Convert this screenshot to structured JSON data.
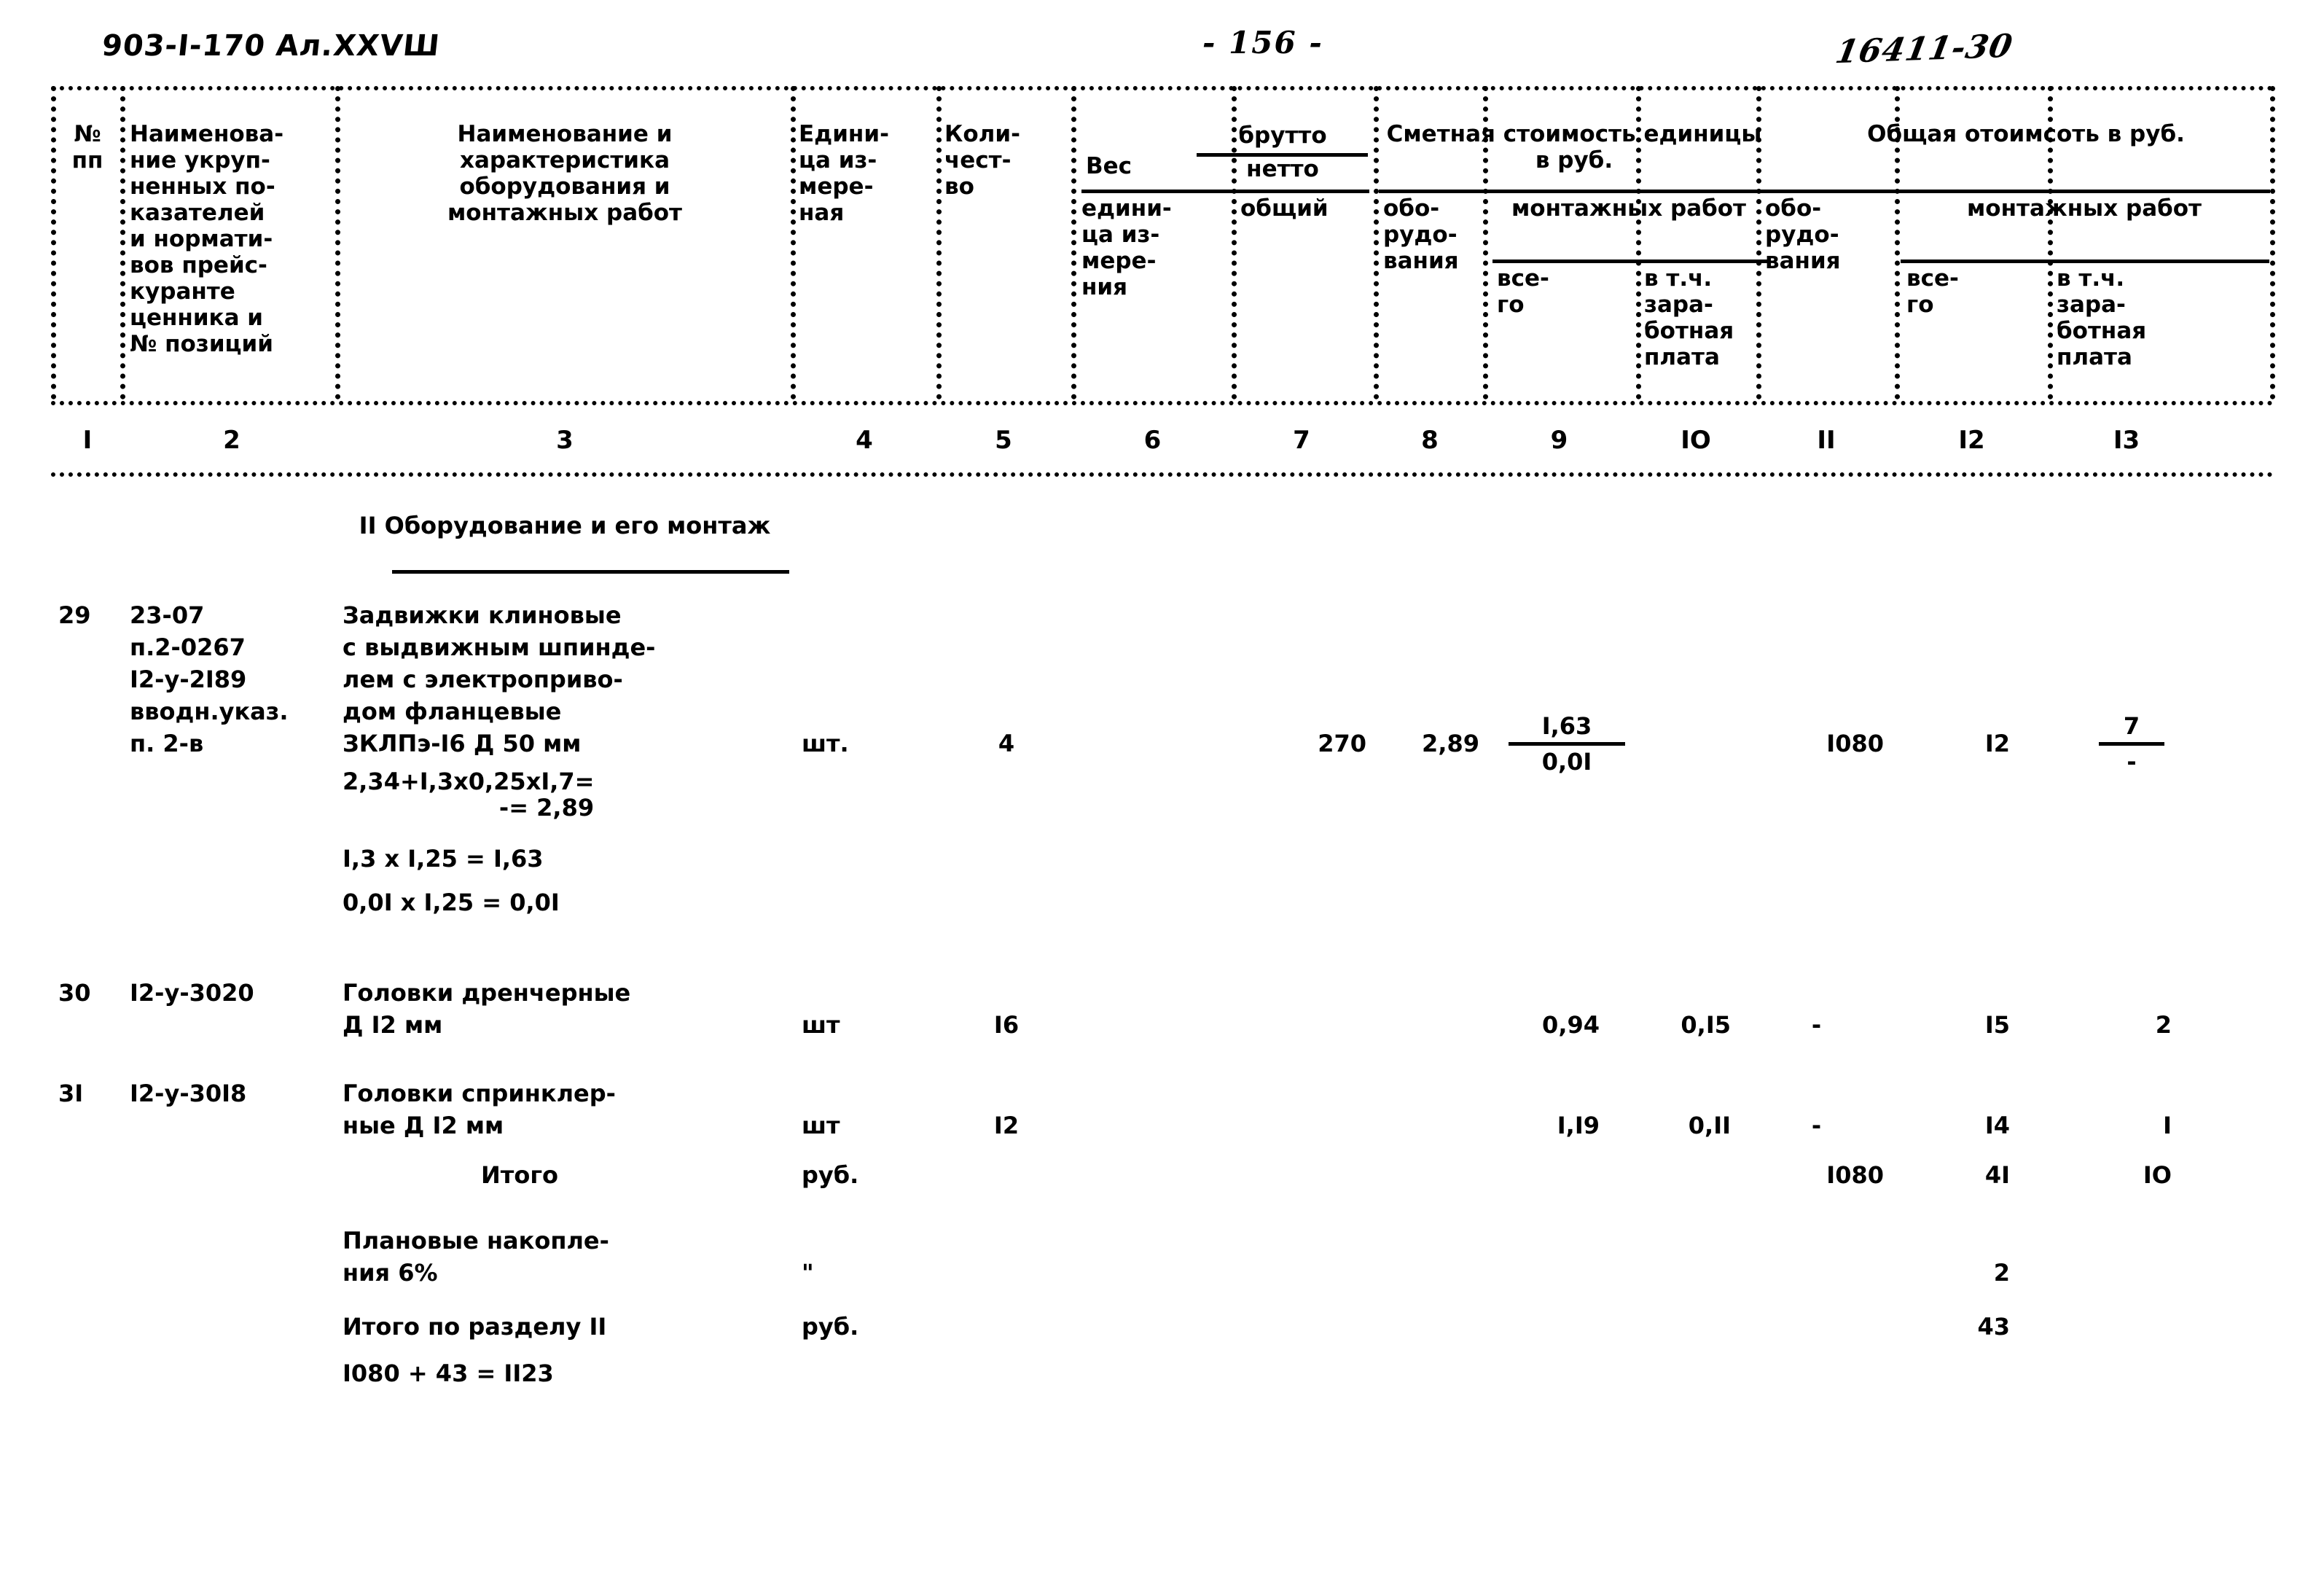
{
  "header": {
    "doc_code": "903-I-170 Ал.XXVШ",
    "page_number": "- 156 -",
    "stamp_number": "16411-30"
  },
  "table": {
    "columns": [
      {
        "num": "I",
        "title": "№\nпп"
      },
      {
        "num": "2",
        "title": "Наименова-\nние укруп-\nненных по-\nказателей\nи нормати-\nвов прейс-\nкуранте\nценника и\n№ позиций"
      },
      {
        "num": "3",
        "title": "Наименование и\nхарактеристика\nоборудования и\nмонтажных работ"
      },
      {
        "num": "4",
        "title": "Едини-\nца из-\nмере-\nная"
      },
      {
        "num": "5",
        "title": "Коли-\nчест-\nво"
      },
      {
        "num": "6",
        "title": "едини-\nца из-\nмере-\nния"
      },
      {
        "num": "7",
        "title": "общий"
      },
      {
        "num": "8",
        "title": "обо-\nрудо-\nвания"
      },
      {
        "num": "9",
        "title": "все-\nго"
      },
      {
        "num": "IO",
        "title": "в т.ч.\nзара-\nботная\nплата"
      },
      {
        "num": "II",
        "title": "обо-\nрудо-\nвания"
      },
      {
        "num": "I2",
        "title": "все-\nго"
      },
      {
        "num": "I3",
        "title": "в т.ч.\nзара-\nботная\nплата"
      }
    ],
    "group_headers": {
      "weight": "Вес",
      "weight_gross": "брутто",
      "weight_net": "нетто",
      "unit_cost": "Сметная стоимость\nединицы  в руб.",
      "total_cost": "Общая отоимсоть\nв руб.",
      "assembly_works_1": "монтажных\nработ",
      "assembly_works_2": "монтажных\nработ"
    }
  },
  "section": {
    "title": "II Оборудование и его\nмонтаж"
  },
  "rows": [
    {
      "no": "29",
      "code": "23-07\nп.2-0267\nI2-у-2I89\nвводн.указ.\nп. 2-в",
      "description": "Задвижки клиновые\nс выдвижным шпинде-\nлем с электроприво-\nдом фланцевые\nЗКЛПэ-I6  Д 50 мм",
      "calc_lines": [
        "2,34+I,3х0,25хI,7=",
        "-= 2,89",
        "I,3 х I,25 = I,63",
        "0,0I х I,25 = 0,0I"
      ],
      "unit": "шт.",
      "qty": "4",
      "weight_unit": "",
      "weight_total": "270",
      "unit_equipment": "2,89",
      "unit_assembly_all": "I,63",
      "unit_assembly_wage": "0,0I",
      "total_equipment": "I080",
      "total_assembly_all": "I2",
      "total_assembly_wage": "7",
      "total_assembly_wage_den": "-"
    },
    {
      "no": "30",
      "code": "I2-у-3020",
      "description": "Головки дренчерные\n        Д I2 мм",
      "unit": "шт",
      "qty": "I6",
      "weight_unit": "",
      "weight_total": "",
      "unit_equipment": "",
      "unit_assembly_all": "0,94",
      "unit_assembly_wage": "0,I5",
      "total_equipment": "-",
      "total_assembly_all": "I5",
      "total_assembly_wage": "2"
    },
    {
      "no": "3I",
      "code": "I2-у-30I8",
      "description": "Головки спринклер-\nные  Д I2 мм",
      "unit": "шт",
      "qty": "I2",
      "weight_unit": "",
      "weight_total": "",
      "unit_equipment": "",
      "unit_assembly_all": "I,I9",
      "unit_assembly_wage": "0,II",
      "total_equipment": "-",
      "total_assembly_all": "I4",
      "total_assembly_wage": "I"
    }
  ],
  "summary": [
    {
      "label": "Итого",
      "unit": "руб.",
      "total_equipment": "I080",
      "total_assembly_all": "4I",
      "total_assembly_wage": "IO"
    },
    {
      "label": "Плановые накопле-\nния 6%",
      "unit": "\"",
      "total_equipment": "",
      "total_assembly_all": "2",
      "total_assembly_wage": ""
    },
    {
      "label": "Итого по разделу II",
      "unit": "руб.",
      "total_equipment": "",
      "total_assembly_all": "43",
      "total_assembly_wage": ""
    }
  ],
  "final_calc": "I080 + 43 = II23"
}
